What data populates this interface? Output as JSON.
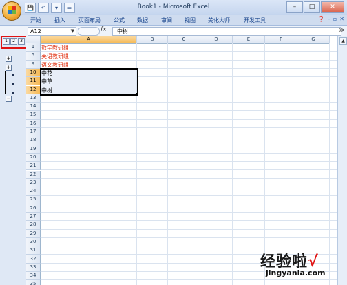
{
  "window": {
    "title": "Book1 - Microsoft Excel",
    "controls": [
      "–",
      "□",
      "✕"
    ]
  },
  "quick_access": [
    "💾",
    "↶",
    "▾",
    "="
  ],
  "ribbon": {
    "tabs": [
      "开始",
      "插入",
      "页面布局",
      "公式",
      "数据",
      "审阅",
      "视图",
      "美化大师",
      "开发工具"
    ]
  },
  "formula_bar": {
    "name_box": "A12",
    "fx": "fx",
    "content": "中树"
  },
  "outline": {
    "levels": [
      "1",
      "2",
      "3"
    ],
    "buttons": [
      "+",
      "+",
      "−"
    ]
  },
  "sheet": {
    "columns": [
      "A",
      "B",
      "C",
      "D",
      "E",
      "F",
      "G"
    ],
    "selected_column": "A",
    "row_numbers": [
      "1",
      "5",
      "9",
      "10",
      "11",
      "12",
      "13",
      "14",
      "15",
      "16",
      "17",
      "18",
      "19",
      "20",
      "21",
      "22",
      "23",
      "24",
      "25",
      "26",
      "27",
      "28",
      "29",
      "30",
      "31",
      "32",
      "33",
      "34",
      "35"
    ],
    "cells": [
      {
        "row": "1",
        "text": "数学教研组",
        "color": "#e03010"
      },
      {
        "row": "5",
        "text": "英语教研组",
        "color": "#e03010"
      },
      {
        "row": "9",
        "text": "语文教研组",
        "color": "#e03010"
      },
      {
        "row": "10",
        "text": "中花",
        "color": "#000000"
      },
      {
        "row": "11",
        "text": "中草",
        "color": "#000000"
      },
      {
        "row": "12",
        "text": "中树",
        "color": "#000000"
      }
    ],
    "selected_rows": [
      "10",
      "11",
      "12"
    ]
  },
  "watermark": {
    "text": "经验啦",
    "check": "√",
    "url": "jingyanla.com"
  }
}
